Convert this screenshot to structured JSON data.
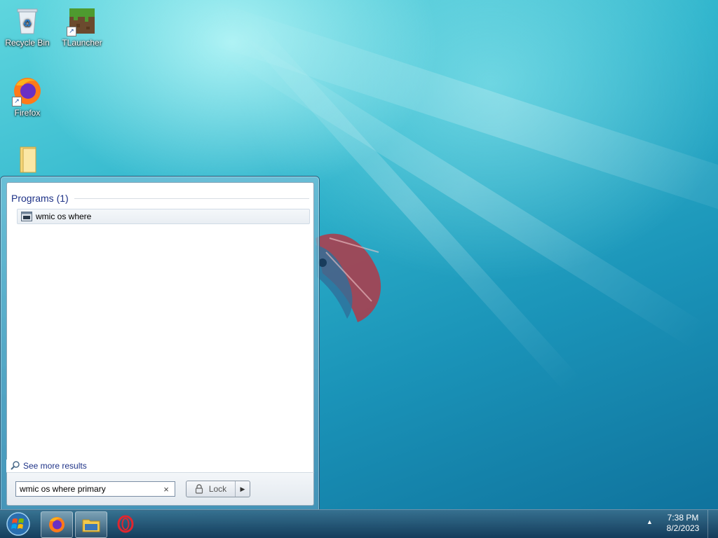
{
  "desktop": {
    "icons": [
      {
        "label": "Recycle Bin"
      },
      {
        "label": "TLauncher"
      },
      {
        "label": "Firefox"
      },
      {
        "label": ""
      }
    ]
  },
  "start_menu": {
    "section_header": "Programs (1)",
    "results": [
      {
        "label": "wmic os where",
        "icon": "console-app-icon"
      }
    ],
    "see_more": "See more results",
    "search": {
      "value": "wmic os where primary",
      "clear_glyph": "×"
    },
    "power_button": {
      "label": "Lock",
      "arrow": "▶"
    }
  },
  "taskbar": {
    "pinned": [
      "start-orb",
      "firefox",
      "file-explorer",
      "opera"
    ],
    "active": "firefox",
    "tray_arrow": "▲",
    "clock": {
      "time": "7:38 PM",
      "date": "8/2/2023"
    }
  },
  "colors": {
    "header_text": "#1e3287",
    "taskbar": "#1d4a6b",
    "desktop_top": "#5fd6de",
    "desktop_bottom": "#0e6f9a"
  }
}
